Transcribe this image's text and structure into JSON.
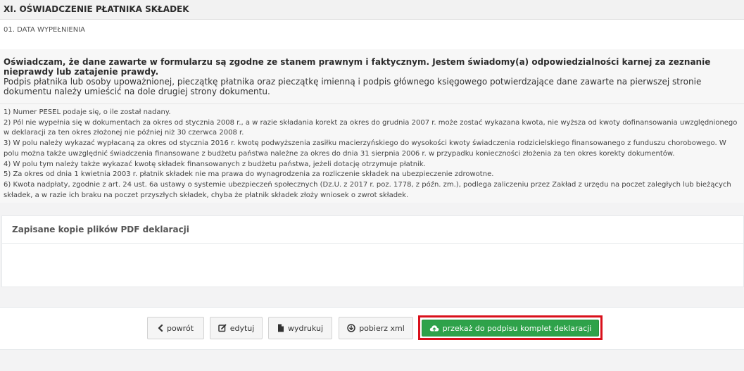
{
  "section": {
    "title": "XI. OŚWIADCZENIE PŁATNIKA SKŁADEK",
    "date_label": "01. DATA WYPEŁNIENIA"
  },
  "declaration": {
    "bold_text": "Oświadczam, że dane zawarte w formularzu są zgodne ze stanem prawnym i faktycznym. Jestem świadomy(a) odpowiedzialności karnej za zeznanie nieprawdy lub zatajenie prawdy.",
    "normal_text": "Podpis płatnika lub osoby upoważnionej, pieczątkę płatnika oraz pieczątkę imienną i podpis głównego księgowego potwierdzające dane zawarte na pierwszej stronie dokumentu należy umieścić na dole drugiej strony dokumentu."
  },
  "footnotes": [
    "1) Numer PESEL podaje się, o ile został nadany.",
    "2) Pól nie wypełnia się w dokumentach za okres od stycznia 2008 r., a w razie składania korekt za okres do grudnia 2007 r. może zostać wykazana kwota, nie wyższa od kwoty dofinansowania uwzględnionego w deklaracji za ten okres złożonej nie później niż 30 czerwca 2008 r.",
    "3) W polu należy wykazać wypłacaną za okres od stycznia 2016 r. kwotę podwyższenia zasiłku macierzyńskiego do wysokości kwoty świadczenia rodzicielskiego finansowanego z funduszu chorobowego. W polu można także uwzględnić świadczenia finansowane z budżetu państwa należne za okres do dnia 31 sierpnia 2006 r. w przypadku konieczności złożenia za ten okres korekty dokumentów.",
    "4) W polu tym należy także wykazać kwotę składek finansowanych z budżetu państwa, jeżeli dotację otrzymuje płatnik.",
    "5) Za okres od dnia 1 kwietnia 2003 r. płatnik składek nie ma prawa do wynagrodzenia za rozliczenie składek na ubezpieczenie zdrowotne.",
    "6) Kwota nadpłaty, zgodnie z art. 24 ust. 6a ustawy o systemie ubezpieczeń społecznych (Dz.U. z 2017 r. poz. 1778, z późn. zm.), podlega zaliczeniu przez Zakład z urzędu na poczet zaległych lub bieżących składek, a w razie ich braku na poczet przyszłych składek, chyba że płatnik składek złoży wniosek o zwrot składek."
  ],
  "pdf_panel": {
    "title": "Zapisane kopie plików PDF deklaracji"
  },
  "actions": {
    "back": "powrót",
    "edit": "edytuj",
    "print": "wydrukuj",
    "download_xml": "pobierz xml",
    "submit": "przekaż do podpisu komplet deklaracji"
  },
  "icons": {
    "back": "chevron-left-icon",
    "edit": "edit-icon",
    "print": "file-icon",
    "download_xml": "download-circle-icon",
    "submit": "cloud-upload-icon"
  },
  "colors": {
    "submit_button": "#2ea24a",
    "highlight_frame": "#d9101b"
  }
}
